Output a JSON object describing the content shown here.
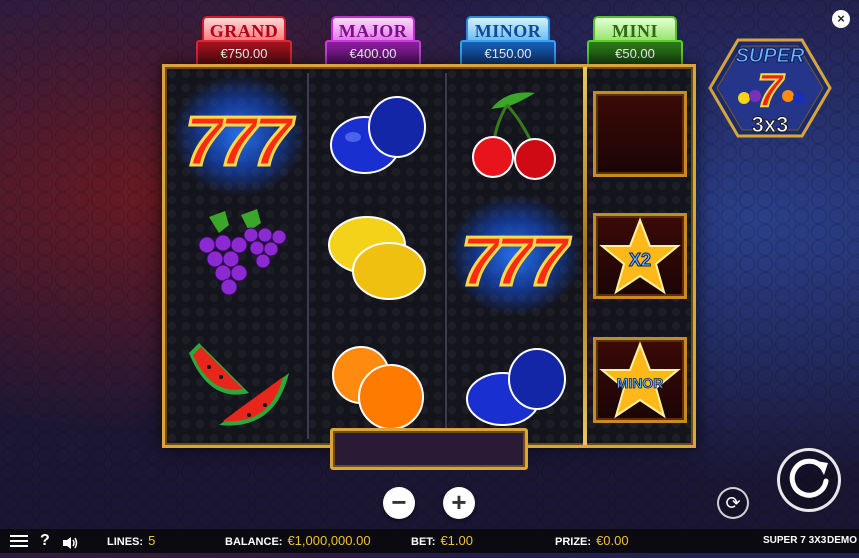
{
  "jackpots": [
    {
      "name": "GRAND",
      "value": "€750.00"
    },
    {
      "name": "MAJOR",
      "value": "€400.00"
    },
    {
      "name": "MINOR",
      "value": "€150.00"
    },
    {
      "name": "MINI",
      "value": "€50.00"
    }
  ],
  "logo": {
    "line1": "SUPER",
    "line2": "7",
    "line3": "3x3"
  },
  "reels": [
    [
      "seven",
      "grapes",
      "watermelon"
    ],
    [
      "plum",
      "lemon",
      "orange"
    ],
    [
      "cherry",
      "seven",
      "plum"
    ]
  ],
  "bonus_reel": [
    {
      "type": "empty",
      "label": ""
    },
    {
      "type": "star",
      "label": "X2"
    },
    {
      "type": "star",
      "label": "MINOR"
    }
  ],
  "controls": {
    "minus_label": "−",
    "plus_label": "+",
    "close_label": "×",
    "autoplay_icon": "autoplay-icon",
    "spin_icon": "spin-icon"
  },
  "bottom_bar": {
    "lines_label": "LINES:",
    "lines_value": "5",
    "balance_label": "BALANCE:",
    "balance_value": "€1,000,000.00",
    "bet_label": "BET:",
    "bet_value": "€1.00",
    "prize_label": "PRIZE:",
    "prize_value": "€0.00",
    "game_name": "SUPER 7 3X3",
    "mode": "DEMO",
    "help_label": "?"
  },
  "colors": {
    "gold_frame": "#d8a53a",
    "value_yellow": "#f2c232"
  }
}
